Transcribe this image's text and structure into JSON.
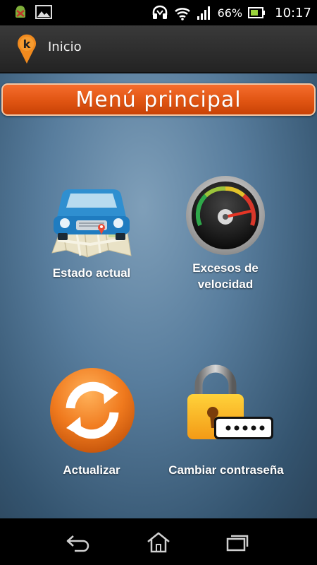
{
  "status_bar": {
    "battery_percent_text": "66%",
    "time": "10:17",
    "icons": [
      "android-debug-icon",
      "gallery-icon",
      "headset-icon",
      "wifi-icon",
      "signal-icon",
      "battery-icon"
    ]
  },
  "action_bar": {
    "title": "Inicio",
    "logo_icon": "map-pin-k-logo-icon"
  },
  "main": {
    "banner_title": "Menú principal",
    "tiles": [
      {
        "label": "Estado actual",
        "icon": "car-map-icon"
      },
      {
        "label_line1": "Excesos de",
        "label_line2": "velocidad",
        "icon": "speedometer-icon"
      },
      {
        "label": "Actualizar",
        "icon": "refresh-icon"
      },
      {
        "label": "Cambiar contraseña",
        "icon": "padlock-password-icon"
      }
    ]
  },
  "nav_bar": {
    "buttons": [
      "back-icon",
      "home-icon",
      "recent-apps-icon"
    ]
  },
  "colors": {
    "banner_orange": "#e05412",
    "content_blue": "#587d9d",
    "action_bar": "#2e2e2e"
  }
}
